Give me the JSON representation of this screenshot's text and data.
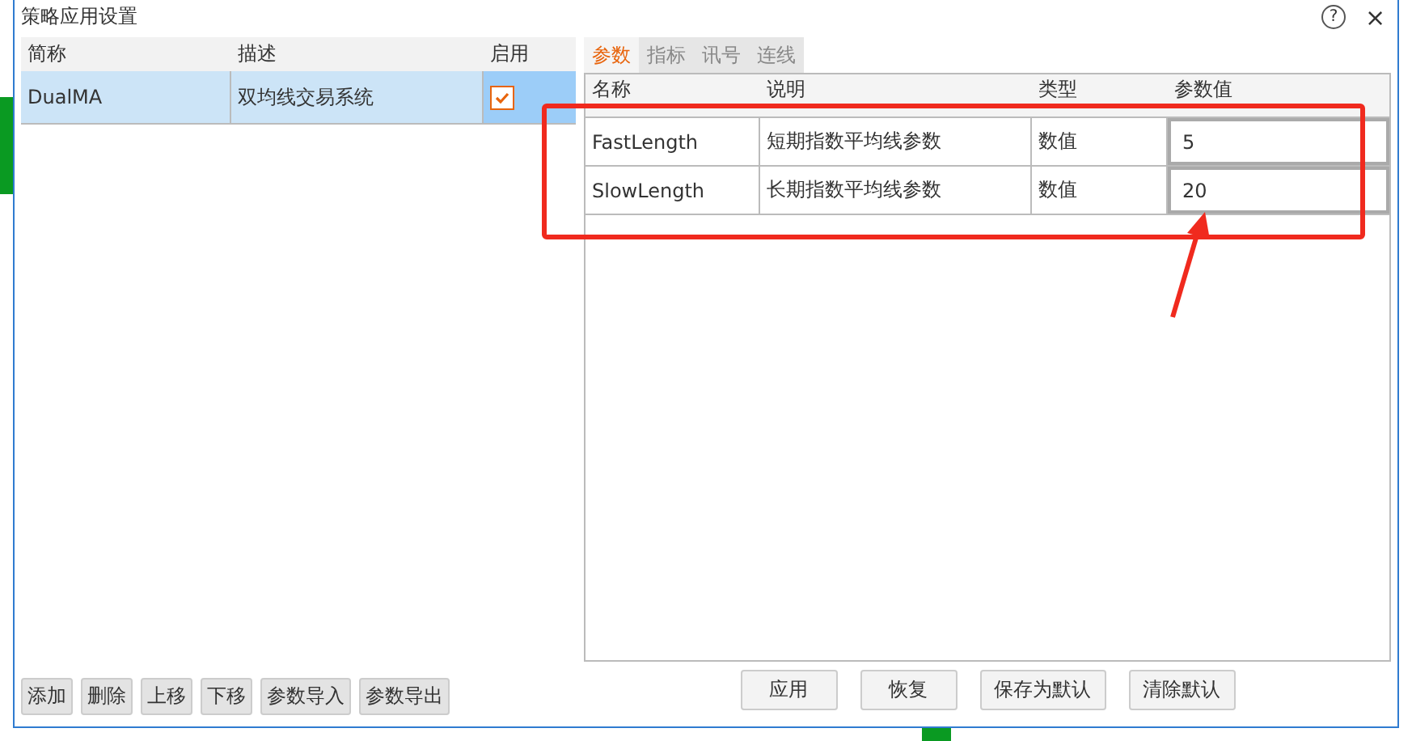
{
  "window": {
    "title": "策略应用设置",
    "help": "?",
    "close": "×"
  },
  "strategies": {
    "columns": [
      "简称",
      "描述",
      "启用"
    ],
    "rows": [
      {
        "name": "DualMA",
        "description": "双均线交易系统",
        "enabled": true,
        "selected": true
      }
    ]
  },
  "left_buttons": [
    "添加",
    "删除",
    "上移",
    "下移",
    "参数导入",
    "参数导出"
  ],
  "tabs": [
    {
      "label": "参数",
      "selected": true
    },
    {
      "label": "指标",
      "selected": false
    },
    {
      "label": "讯号",
      "selected": false
    },
    {
      "label": "连线",
      "selected": false
    }
  ],
  "params": {
    "columns": [
      "名称",
      "说明",
      "类型",
      "参数值"
    ],
    "rows": [
      {
        "name": "FastLength",
        "description": "短期指数平均线参数",
        "type": "数值",
        "value": "5"
      },
      {
        "name": "SlowLength",
        "description": "长期指数平均线参数",
        "type": "数值",
        "value": "20"
      }
    ]
  },
  "right_buttons": [
    "应用",
    "恢复",
    "保存为默认",
    "清除默认"
  ]
}
